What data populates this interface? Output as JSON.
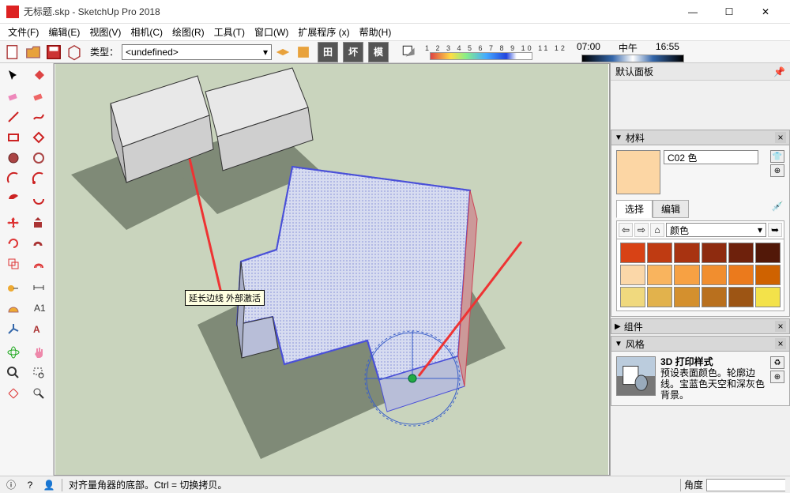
{
  "window": {
    "title": "无标题.skp - SketchUp Pro 2018",
    "min": "—",
    "max": "☐",
    "close": "✕"
  },
  "menu": {
    "file": "文件(F)",
    "edit": "编辑(E)",
    "view": "视图(V)",
    "camera": "相机(C)",
    "draw": "绘图(R)",
    "tools": "工具(T)",
    "window": "窗口(W)",
    "extensions": "扩展程序 (x)",
    "help": "帮助(H)"
  },
  "toolbar": {
    "type_label": "类型：",
    "type_value": "<undefined>",
    "hash1": "田",
    "hash2": "坏",
    "hash3": "模",
    "time_nums": "1 2 3 4 5 6 7 8 9 10 11 12",
    "time_a": "07:00",
    "time_b": "中午",
    "time_c": "16:55"
  },
  "viewport": {
    "tooltip": "延长边线 外部激活"
  },
  "panel": {
    "default_panel": "默认面板",
    "materials": "材料",
    "material_name": "C02 色",
    "tab_select": "选择",
    "tab_edit": "编辑",
    "category": "颜色",
    "swatches": [
      "#d84215",
      "#bf3b12",
      "#a83311",
      "#8e2b0f",
      "#6e210c",
      "#521808",
      "#fbd7a8",
      "#f9b45e",
      "#f7a143",
      "#f18e2f",
      "#eb7a1c",
      "#cf6200",
      "#f0d97e",
      "#e2b24c",
      "#d4902e",
      "#b9701e",
      "#9d5514",
      "#f3e24a"
    ],
    "components": "组件",
    "style": "风格",
    "style_name": "3D 打印样式",
    "style_desc": "预设表面颜色。轮廓边线。宝蓝色天空和深灰色背景。"
  },
  "status": {
    "hint": "对齐量角器的底部。Ctrl = 切换拷贝。",
    "angle_label": "角度"
  }
}
